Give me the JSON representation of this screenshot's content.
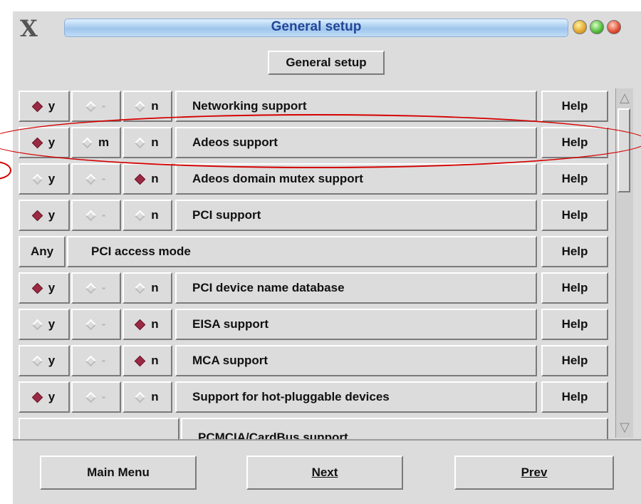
{
  "window": {
    "title": "General setup",
    "logo": "X",
    "controls": [
      "minimize",
      "maximize",
      "close"
    ]
  },
  "header_button": "General setup",
  "rows": [
    {
      "type": "tristate",
      "y_label": "y",
      "m_label": "-",
      "n_label": "n",
      "selected": "y",
      "m_enabled": false,
      "name": "Networking support",
      "help": "Help"
    },
    {
      "type": "tristate",
      "y_label": "y",
      "m_label": "m",
      "n_label": "n",
      "selected": "y",
      "m_enabled": true,
      "name": "Adeos support",
      "help": "Help"
    },
    {
      "type": "tristate",
      "y_label": "y",
      "m_label": "-",
      "n_label": "n",
      "selected": "n",
      "m_enabled": false,
      "name": "Adeos domain mutex support",
      "help": "Help"
    },
    {
      "type": "tristate",
      "y_label": "y",
      "m_label": "-",
      "n_label": "n",
      "selected": "y",
      "m_enabled": false,
      "name": "PCI support",
      "help": "Help"
    },
    {
      "type": "choice",
      "value": "Any",
      "name": "PCI access mode",
      "help": "Help"
    },
    {
      "type": "tristate",
      "y_label": "y",
      "m_label": "-",
      "n_label": "n",
      "selected": "y",
      "m_enabled": false,
      "name": "PCI device name database",
      "help": "Help"
    },
    {
      "type": "tristate",
      "y_label": "y",
      "m_label": "-",
      "n_label": "n",
      "selected": "n",
      "m_enabled": false,
      "name": "EISA support",
      "help": "Help"
    },
    {
      "type": "tristate",
      "y_label": "y",
      "m_label": "-",
      "n_label": "n",
      "selected": "n",
      "m_enabled": false,
      "name": "MCA support",
      "help": "Help"
    },
    {
      "type": "tristate",
      "y_label": "y",
      "m_label": "-",
      "n_label": "n",
      "selected": "y",
      "m_enabled": false,
      "name": "Support for hot-pluggable devices",
      "help": "Help"
    },
    {
      "type": "submenu",
      "name": "PCMCIA/CardBus support"
    }
  ],
  "footer": {
    "main_menu": "Main Menu",
    "next": "Next",
    "prev": "Prev"
  },
  "colors": {
    "selected_diamond": "#9a2a44",
    "title_text": "#24479a",
    "annotation": "#d40000"
  }
}
